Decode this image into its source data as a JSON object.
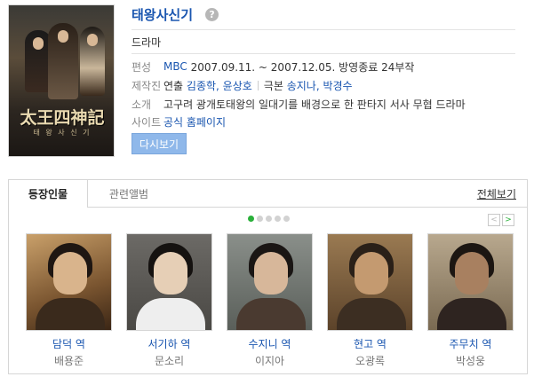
{
  "poster": {
    "hanja_title": "太王四神記",
    "sub_title": "태 왕 사 신 기"
  },
  "info": {
    "title": "태왕사신기",
    "help_glyph": "?",
    "genre": "드라마",
    "rows": [
      {
        "label": "편성",
        "channel": "MBC",
        "period": "2007.09.11. ~ 2007.12.05. 방영종료 24부작"
      },
      {
        "label": "제작진",
        "directing_label": "연출",
        "directors": "김종학, 윤상호",
        "writing_label": "극본",
        "writers": "송지나, 박경수"
      },
      {
        "label": "소개",
        "text": "고구려 광개토태왕의 일대기를 배경으로 한 판타지 서사 무협 드라마"
      },
      {
        "label": "사이트",
        "link": "공식 홈페이지"
      }
    ],
    "replay_button": "다시보기"
  },
  "cast_panel": {
    "tabs": [
      "등장인물",
      "관련앨범"
    ],
    "view_all": "전체보기",
    "page_dots": 5,
    "active_dot": 0,
    "prev_glyph": "<",
    "next_glyph": ">",
    "cast": [
      {
        "role": "담덕 역",
        "actor": "배용준"
      },
      {
        "role": "서기하 역",
        "actor": "문소리"
      },
      {
        "role": "수지니 역",
        "actor": "이지아"
      },
      {
        "role": "현고 역",
        "actor": "오광록"
      },
      {
        "role": "주무치 역",
        "actor": "박성웅"
      }
    ]
  },
  "colors": {
    "link": "#1a56b0",
    "button": "#8fb8ea",
    "active_dot": "#2ab03a"
  }
}
